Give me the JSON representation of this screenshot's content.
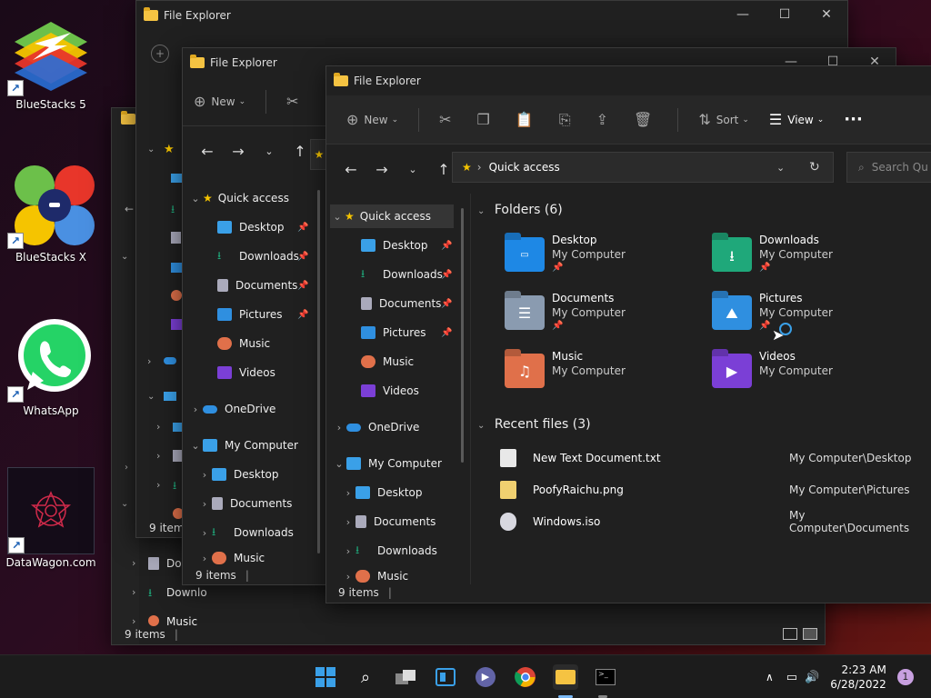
{
  "desktop": {
    "icons": [
      {
        "label": "BlueStacks 5"
      },
      {
        "label": "BlueStacks X"
      },
      {
        "label": "WhatsApp"
      },
      {
        "label": "DataWagon.com"
      }
    ]
  },
  "back_window": {
    "title": "File Explorer",
    "status": "9 items",
    "partial_items": [
      "Doc",
      "Downlo",
      "Music"
    ]
  },
  "back_window_2": {
    "status": "9 items"
  },
  "mid_window": {
    "title": "File Explorer",
    "toolbar_new": "New",
    "status": "9 items",
    "nav": [
      {
        "label": "Quick access"
      },
      {
        "label": "Desktop"
      },
      {
        "label": "Downloads"
      },
      {
        "label": "Documents"
      },
      {
        "label": "Pictures"
      },
      {
        "label": "Music"
      },
      {
        "label": "Videos"
      },
      {
        "label": "OneDrive"
      },
      {
        "label": "My Computer"
      },
      {
        "label": "Desktop"
      },
      {
        "label": "Documents"
      },
      {
        "label": "Downloads"
      },
      {
        "label": "Music"
      }
    ]
  },
  "front_window": {
    "title": "File Explorer",
    "toolbar": {
      "new": "New",
      "sort": "Sort",
      "view": "View"
    },
    "address": "Quick access",
    "search_placeholder": "Search Qu",
    "status": "9 items",
    "nav": [
      {
        "label": "Quick access"
      },
      {
        "label": "Desktop"
      },
      {
        "label": "Downloads"
      },
      {
        "label": "Documents"
      },
      {
        "label": "Pictures"
      },
      {
        "label": "Music"
      },
      {
        "label": "Videos"
      },
      {
        "label": "OneDrive"
      },
      {
        "label": "My Computer"
      },
      {
        "label": "Desktop"
      },
      {
        "label": "Documents"
      },
      {
        "label": "Downloads"
      },
      {
        "label": "Music"
      }
    ],
    "folders_header": "Folders (6)",
    "folders": [
      {
        "name": "Desktop",
        "loc": "My Computer",
        "color": "#1e88e5"
      },
      {
        "name": "Downloads",
        "loc": "My Computer",
        "color": "#1fa87a"
      },
      {
        "name": "Documents",
        "loc": "My Computer",
        "color": "#8a9bb0"
      },
      {
        "name": "Pictures",
        "loc": "My Computer",
        "color": "#2f8fe0"
      },
      {
        "name": "Music",
        "loc": "My Computer",
        "color": "#e0704a"
      },
      {
        "name": "Videos",
        "loc": "My Computer",
        "color": "#7b3fd6"
      }
    ],
    "recent_header": "Recent files (3)",
    "recent": [
      {
        "name": "New Text Document.txt",
        "loc": "My Computer\\Desktop"
      },
      {
        "name": "PoofyRaichu.png",
        "loc": "My Computer\\Pictures"
      },
      {
        "name": "Windows.iso",
        "loc": "My Computer\\Documents"
      }
    ]
  },
  "taskbar": {
    "time": "2:23 AM",
    "date": "6/28/2022",
    "notifications": "1"
  }
}
